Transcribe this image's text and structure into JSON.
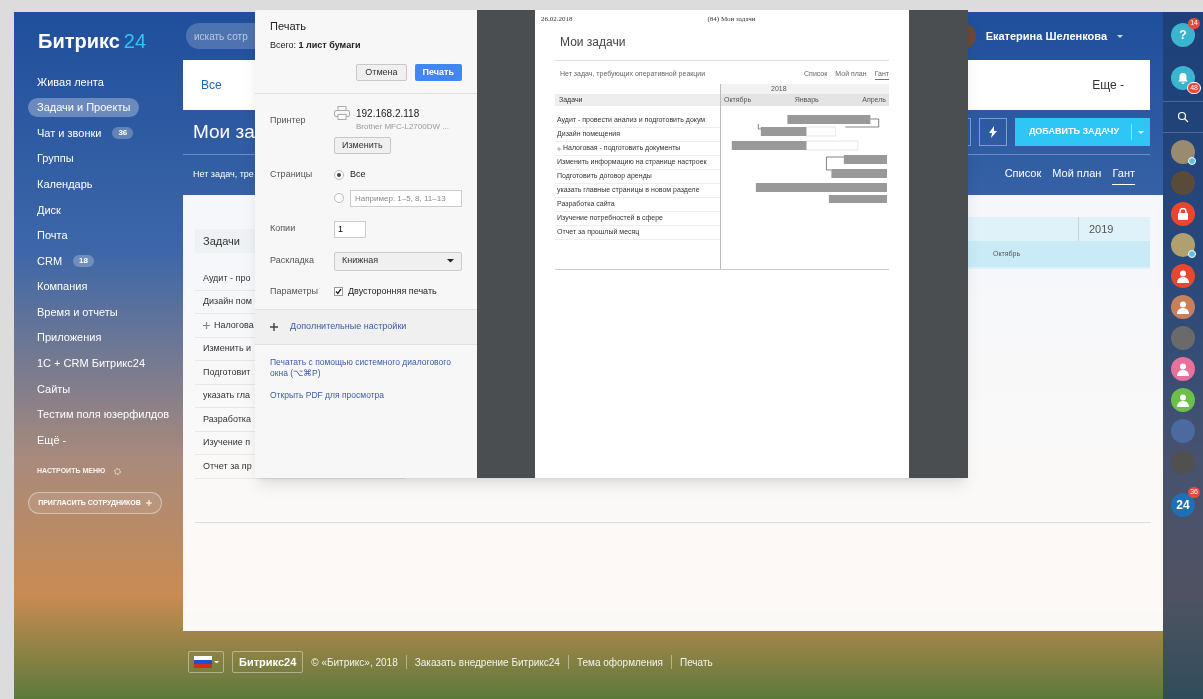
{
  "sidebar": {
    "logo": {
      "name": "Битрикс",
      "number": "24"
    },
    "items": [
      {
        "label": "Живая лента",
        "selected": false
      },
      {
        "label": "Задачи и Проекты",
        "selected": true
      },
      {
        "label": "Чат и звонки",
        "selected": false,
        "badge": "36"
      },
      {
        "label": "Группы",
        "selected": false
      },
      {
        "label": "Календарь",
        "selected": false
      },
      {
        "label": "Диск",
        "selected": false
      },
      {
        "label": "Почта",
        "selected": false
      },
      {
        "label": "CRM",
        "selected": false,
        "badge": "18"
      },
      {
        "label": "Компания",
        "selected": false
      },
      {
        "label": "Время и отчеты",
        "selected": false
      },
      {
        "label": "Приложения",
        "selected": false
      },
      {
        "label": "1С + CRM Битрикс24",
        "selected": false
      },
      {
        "label": "Сайты",
        "selected": false
      },
      {
        "label": "Тестим поля юзерфилдов",
        "selected": false
      },
      {
        "label": "Ещё -",
        "selected": false
      }
    ],
    "settings": "НАСТРОИТЬ МЕНЮ",
    "invite": "ПРИГЛАСИТЬ СОТРУДНИКОВ"
  },
  "header": {
    "search": {
      "placeholder": "искать сотр"
    },
    "user": "Екатерина Шеленкова"
  },
  "tabs": [
    {
      "label": "Все",
      "selected": true
    }
  ],
  "more": "Еще -",
  "title": "Мои за",
  "add_button": "ДОБАВИТЬ ЗАДАЧУ",
  "notice": "Нет задач, тре",
  "views": [
    {
      "label": "Список",
      "selected": false
    },
    {
      "label": "Мой план",
      "selected": false
    },
    {
      "label": "Гант",
      "selected": true
    }
  ],
  "task_table": {
    "header": "Задачи",
    "rows": [
      {
        "text": "Аудит - про",
        "expandable": false
      },
      {
        "text": "Дизайн пом",
        "expandable": false
      },
      {
        "text": "Налогова",
        "expandable": true
      },
      {
        "text": "Изменить и",
        "expandable": false
      },
      {
        "text": "Подготовит",
        "expandable": false
      },
      {
        "text": "указать гла",
        "expandable": false
      },
      {
        "text": "Разработка",
        "expandable": false
      },
      {
        "text": "Изучение п",
        "expandable": false
      },
      {
        "text": "Отчет за пр",
        "expandable": false
      }
    ]
  },
  "gantt": {
    "year": "2019",
    "month": "Октябрь"
  },
  "right_rail": {
    "help_label": "?",
    "help_badge": "14",
    "bell_badge": "48",
    "app_label": "24",
    "app_badge": "36",
    "avatars": [
      {
        "kind": "photo",
        "color": "#9a8a70",
        "online": true
      },
      {
        "kind": "photo",
        "color": "#5a4a3a",
        "online": false
      },
      {
        "kind": "lock",
        "color": "#e8472f",
        "online": false
      },
      {
        "kind": "photo",
        "color": "#b0a070",
        "online": true
      },
      {
        "kind": "user",
        "color": "#e8472f",
        "online": false
      },
      {
        "kind": "user",
        "color": "#c9805a",
        "online": false
      },
      {
        "kind": "photo",
        "color": "#6a6a6a",
        "online": false
      },
      {
        "kind": "user",
        "color": "#e8709a",
        "online": false
      },
      {
        "kind": "user",
        "color": "#6cc04a",
        "online": false
      },
      {
        "kind": "photo",
        "color": "#4a6aa0",
        "online": false
      },
      {
        "kind": "photo",
        "color": "#505050",
        "online": false
      }
    ]
  },
  "footer": {
    "logo": "Битрикс24",
    "copyright": "© «Битрикс», 2018",
    "links": [
      "Заказать внедрение Битрикс24",
      "Тема оформления",
      "Печать"
    ]
  },
  "print_dialog": {
    "title": "Печать",
    "total": "Всего: **1 лист бумаги**",
    "cancel": "Отмена",
    "print": "Печать",
    "printer": {
      "label": "Принтер",
      "name": "192.168.2.118",
      "model": "Brother MFC-L2700DW ...",
      "change": "Изменить"
    },
    "pages": {
      "label": "Страницы",
      "options": [
        {
          "kind": "all",
          "label": "Все",
          "selected": true
        },
        {
          "kind": "range",
          "placeholder": "Например: 1–5, 8, 11–13",
          "selected": false
        }
      ]
    },
    "copies": {
      "label": "Копии",
      "value": "1"
    },
    "layout": {
      "label": "Раскладка",
      "value": "Книжная"
    },
    "params": {
      "label": "Параметры",
      "option": "Двусторонняя печать",
      "checked": true
    },
    "more_settings": "Дополнительные настройки",
    "system_dialog": "Печатать с помощью системного диалогового окна (⌥⌘P)",
    "open_pdf": "Открыть PDF для просмотра",
    "preview": {
      "date": "26.02.2018",
      "header": "(84) Мои задачи",
      "title": "Мои задачи",
      "notice": "Нет задач, требующих оперативной реакции",
      "views": [
        {
          "label": "Список",
          "selected": false
        },
        {
          "label": "Мой план",
          "selected": false
        },
        {
          "label": "Гант",
          "selected": true
        }
      ],
      "table_header": "Задачи",
      "year": "2018",
      "months": [
        "Октябрь",
        "Январь",
        "Апрель"
      ],
      "rows": [
        {
          "text": "Аудит - провести анализ и подготовить докум",
          "expandable": false
        },
        {
          "text": "Дизайн помещения",
          "expandable": false
        },
        {
          "text": "Налоговая - подготовить документы",
          "expandable": true
        },
        {
          "text": "Изменить информацию на странице настроек",
          "expandable": false
        },
        {
          "text": "Подготовить договор аренды",
          "expandable": false
        },
        {
          "text": "указать главные страницы в новом разделе",
          "expandable": false
        },
        {
          "text": "Разработка сайта",
          "expandable": false
        },
        {
          "text": "Изучение потребностей в сфере",
          "expandable": false
        },
        {
          "text": "Отчет за прошлый месяц",
          "expandable": false
        }
      ]
    }
  }
}
